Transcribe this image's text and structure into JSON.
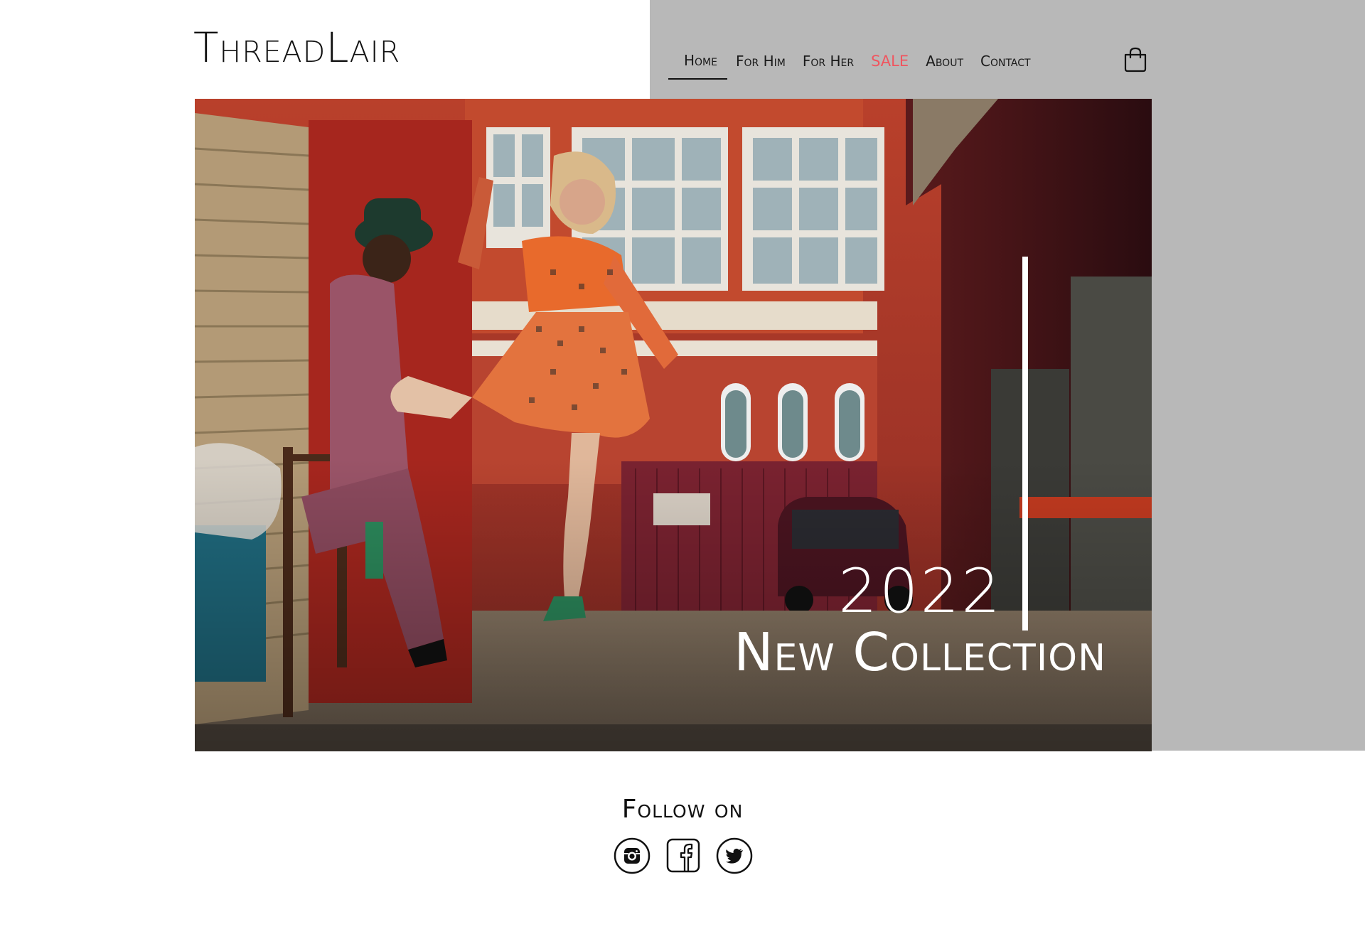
{
  "brand": {
    "logo_text": "ThreadLair"
  },
  "nav": {
    "items": [
      {
        "label": "Home",
        "active": true
      },
      {
        "label": "For Him"
      },
      {
        "label": "For Her"
      },
      {
        "label": "SALE",
        "highlight_color": "#f0555f"
      },
      {
        "label": "About"
      },
      {
        "label": "Contact"
      }
    ],
    "cart_icon": "shopping-bag-icon"
  },
  "hero": {
    "year": "2022",
    "title": "New Collection"
  },
  "follow": {
    "heading": "Follow on",
    "icons": [
      "instagram-icon",
      "facebook-icon",
      "twitter-icon"
    ]
  },
  "colors": {
    "gray_panel": "#b8b8b8",
    "sale_accent": "#f0555f",
    "text": "#111111"
  }
}
